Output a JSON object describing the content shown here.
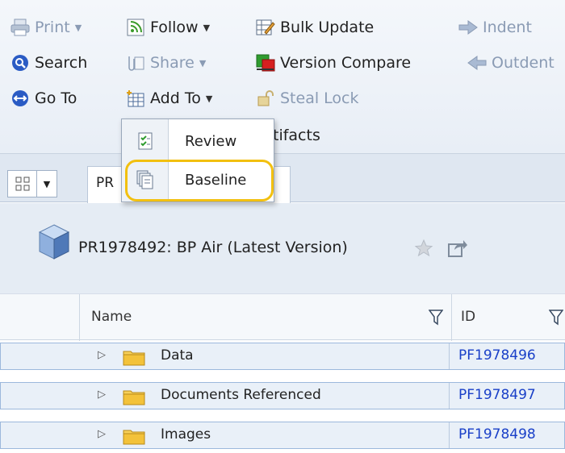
{
  "toolbar": {
    "print": "Print",
    "follow": "Follow",
    "bulk_update": "Bulk Update",
    "indent": "Indent",
    "search": "Search",
    "share": "Share",
    "version_compare": "Version Compare",
    "outdent": "Outdent",
    "go_to": "Go To",
    "add_to": "Add To",
    "steal_lock": "Steal Lock",
    "artifacts_fragment": "tifacts"
  },
  "add_to_menu": {
    "items": [
      {
        "label": "Review",
        "icon": "review-icon"
      },
      {
        "label": "Baseline",
        "icon": "baseline-icon"
      }
    ]
  },
  "tabs": {
    "active_tab": "PR"
  },
  "object": {
    "title": "PR1978492: BP Air (Latest Version)"
  },
  "table": {
    "columns": [
      "Name",
      "ID"
    ],
    "rows": [
      {
        "name": "Data",
        "id": "PF1978496"
      },
      {
        "name": "Documents Referenced",
        "id": "PF1978497"
      },
      {
        "name": "Images",
        "id": "PF1978498"
      }
    ]
  },
  "colors": {
    "link": "#1a40c8",
    "highlight": "#f2c010",
    "disabled_text": "#8a9bb4"
  }
}
